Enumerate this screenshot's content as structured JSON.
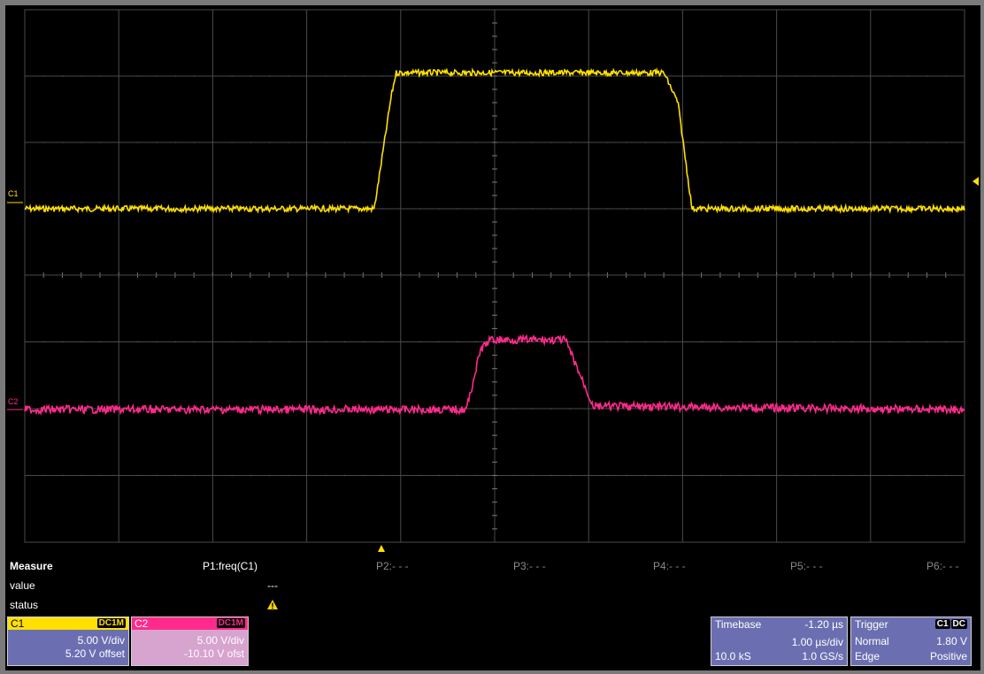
{
  "measure": {
    "title": "Measure",
    "row_labels": [
      "value",
      "status"
    ],
    "params": [
      {
        "label": "P1:freq(C1)",
        "value": "---",
        "status": "warning-icon",
        "active": true
      },
      {
        "label": "P2:- - -",
        "active": false
      },
      {
        "label": "P3:- - -",
        "active": false
      },
      {
        "label": "P4:- - -",
        "active": false
      },
      {
        "label": "P5:- - -",
        "active": false
      },
      {
        "label": "P6:- - -",
        "active": false
      }
    ]
  },
  "channels": [
    {
      "name": "C1",
      "coupling": "DC1M",
      "vdiv": "5.00 V/div",
      "offset": "5.20 V offset",
      "color": "#ffe000"
    },
    {
      "name": "C2",
      "coupling": "DC1M",
      "vdiv": "5.00 V/div",
      "offset": "-10.10 V ofst",
      "color": "#ff2a8c"
    }
  ],
  "timebase": {
    "label": "Timebase",
    "delay": "-1.20 µs",
    "tdiv": "1.00 µs/div",
    "samples": "10.0 kS",
    "rate": "1.0 GS/s"
  },
  "trigger": {
    "label": "Trigger",
    "source": "C1",
    "coupling": "DC",
    "mode": "Normal",
    "level": "1.80 V",
    "type": "Edge",
    "slope": "Positive"
  },
  "trace_labels": {
    "c1": "C1",
    "c2": "C2"
  },
  "colors": {
    "trace_c1": "#ffe000",
    "trace_c2": "#ff2a8c",
    "grid": "#4a4a4a",
    "panel": "#6b6fb1"
  },
  "chart_data": {
    "type": "line",
    "x_divisions": 10,
    "y_divisions_per_grid": 4,
    "x_unit": "div",
    "series": [
      {
        "name": "C1",
        "x": [
          0,
          3.72,
          3.9,
          3.95,
          6.8,
          6.95,
          7.1,
          10
        ],
        "y": [
          0,
          0,
          1.7,
          2.05,
          2.05,
          1.6,
          0.0,
          0
        ]
      },
      {
        "name": "C2",
        "x": [
          0,
          4.7,
          4.85,
          4.95,
          5.75,
          5.9,
          6.05,
          10
        ],
        "y": [
          0,
          0,
          0.9,
          1.05,
          1.05,
          0.55,
          0.05,
          0
        ]
      }
    ]
  }
}
